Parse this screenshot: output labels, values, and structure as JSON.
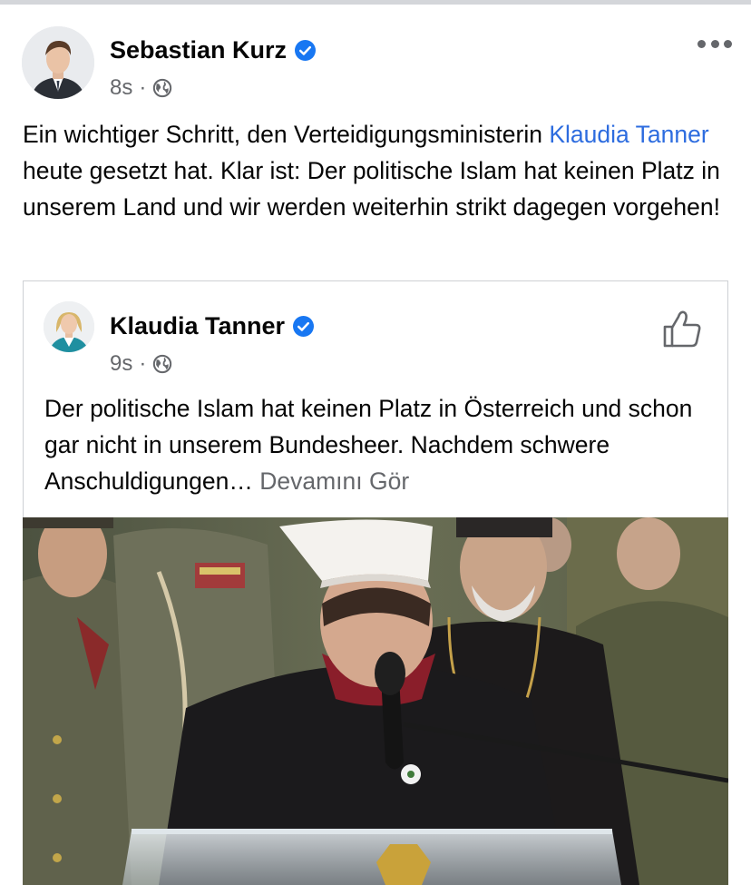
{
  "post": {
    "author_name": "Sebastian Kurz",
    "time": "8s",
    "meta_separator": "·",
    "text_before_mention": "Ein wichtiger Schritt, den Verteidigungsministerin ",
    "mention": "Klaudia Tanner",
    "text_after_mention": " heute gesetzt hat. Klar ist: Der politische Islam hat keinen Platz in unserem Land und wir werden weiterhin strikt dagegen vorgehen!"
  },
  "shared_post": {
    "author_name": "Klaudia Tanner",
    "time": "9s",
    "meta_separator": "·",
    "text": "Der politische Islam hat keinen Platz in Österreich und schon gar nicht in unserem Bundesheer. Nachdem schwere Anschuldigungen… ",
    "see_more": "Devamını Gör"
  },
  "icons": {
    "verified": "verified-badge-icon",
    "audience": "globe-icon",
    "more": "more-options-icon",
    "like": "thumbs-up-icon"
  },
  "colors": {
    "verified_blue": "#1877f2",
    "mention_blue": "#2d6cdf",
    "secondary_text": "#65676b"
  }
}
